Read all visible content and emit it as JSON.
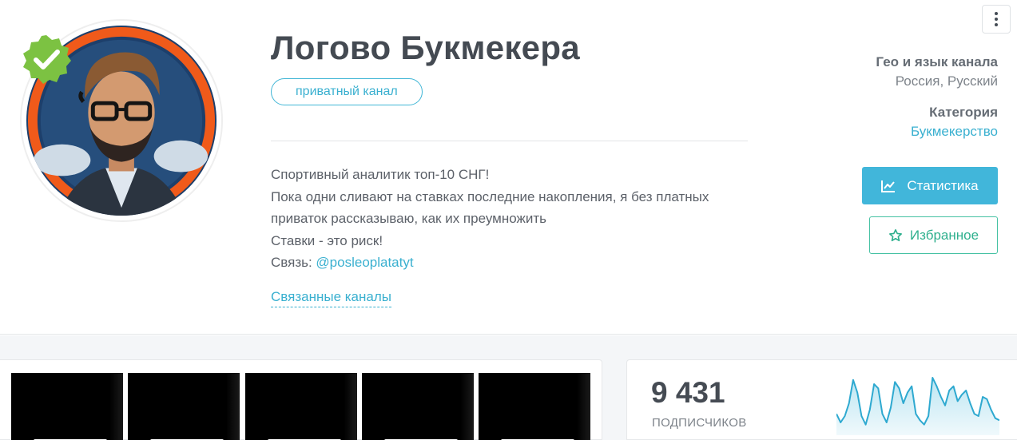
{
  "channel": {
    "title": "Логово Букмекера",
    "tag": "приватный канал",
    "description_lines": [
      "Спортивный аналитик топ-10 СНГ!",
      "Пока одни сливают на ставках последние накопления, я без платных",
      "приваток рассказываю, как их преумножить",
      "Ставки - это риск!"
    ],
    "contact_prefix": "Связь: ",
    "contact_link": "@posleoplatatyt",
    "related_link": "Связанные каналы"
  },
  "info": {
    "geo_label": "Гео и язык канала",
    "geo_value": "Россия, Русский",
    "category_label": "Категория",
    "category_value": "Букмекерство"
  },
  "actions": {
    "stats_label": "Статистика",
    "favorite_label": "Избранное"
  },
  "stats": {
    "subscribers_count": "9 431",
    "subscribers_label": "подписчиков",
    "sparkline_values": [
      60,
      52,
      58,
      70,
      92,
      80,
      58,
      50,
      64,
      88,
      84,
      60,
      52,
      66,
      90,
      84,
      70,
      80,
      86,
      60,
      54,
      50,
      58,
      94,
      86,
      76,
      68,
      82,
      86,
      72,
      78,
      82,
      70,
      60,
      58,
      76,
      74,
      64,
      56,
      54
    ]
  },
  "colors": {
    "accent": "#41b6da",
    "favorite": "#46c2a3",
    "verified": "#7cc242"
  },
  "icons": {
    "menu": "vertical-dots-icon",
    "verified": "verified-badge-icon",
    "stats": "line-chart-icon",
    "favorite": "star-outline-icon"
  }
}
